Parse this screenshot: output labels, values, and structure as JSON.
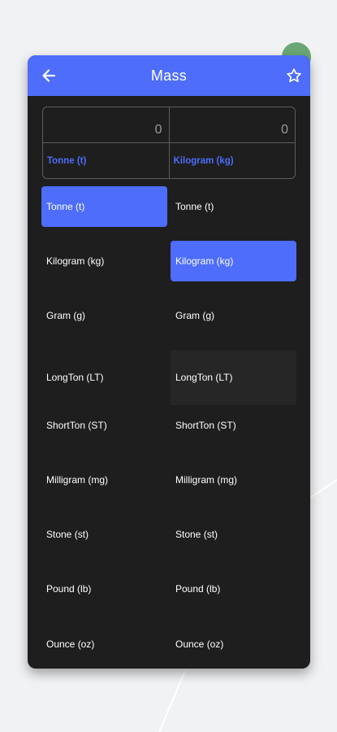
{
  "header": {
    "title": "Mass",
    "back_icon": "arrow-left-icon",
    "favorite_icon": "star-outline-icon"
  },
  "converter": {
    "from": {
      "value": "0",
      "unit": "Tonne (t)"
    },
    "to": {
      "value": "0",
      "unit": "Kilogram (kg)"
    }
  },
  "from_list": [
    "Tonne (t)",
    "Kilogram (kg)",
    "Gram (g)",
    "LongTon (LT)",
    "ShortTon (ST)",
    "Milligram (mg)",
    "Stone (st)",
    "Pound (lb)",
    "Ounce (oz)"
  ],
  "to_list": [
    "Tonne (t)",
    "Kilogram (kg)",
    "Gram (g)",
    "LongTon (LT)",
    "ShortTon (ST)",
    "Milligram (mg)",
    "Stone (st)",
    "Pound (lb)",
    "Ounce (oz)"
  ],
  "colors": {
    "accent": "#4d6dfa",
    "card": "#1e1e1e",
    "background": "#f1f2f4"
  }
}
